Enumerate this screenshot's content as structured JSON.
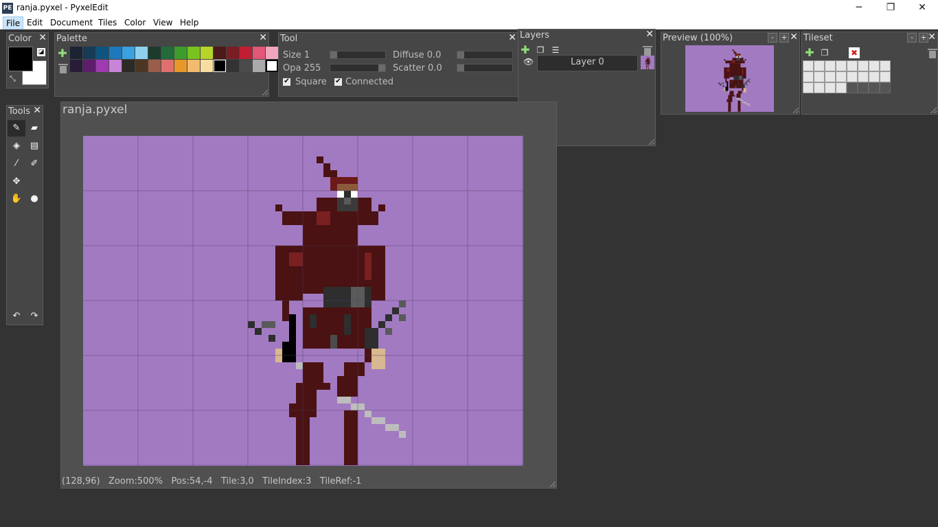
{
  "window": {
    "title": "ranja.pyxel - PyxelEdit",
    "icon_text": "PE",
    "minimize": "─",
    "restore": "❐",
    "close": "✕"
  },
  "menu": [
    "File",
    "Edit",
    "Document",
    "Tiles",
    "Color",
    "View",
    "Help"
  ],
  "color_panel": {
    "title": "Color",
    "fg": "#000000",
    "bg": "#ffffff"
  },
  "palette_panel": {
    "title": "Palette",
    "row1": [
      "#1c2433",
      "#173a55",
      "#0e5480",
      "#1e78b9",
      "#3aa0e0",
      "#8ed1ef",
      "#1d3b2c",
      "#236b3b",
      "#3e9c2c",
      "#79c21f",
      "#b6d42a",
      "#4d1a1a",
      "#7a1e24",
      "#c01e32",
      "#e25678",
      "#f0a6bd"
    ],
    "row2": [
      "#2a1b3a",
      "#5e1d6b",
      "#a03ab3",
      "#c885d8",
      "#2d2a25",
      "#4a3623",
      "#9a5d4a",
      "#e07070",
      "#e8982a",
      "#f2bb70",
      "#f7dea0",
      "#000000",
      "#333333",
      "#4b4b4b",
      "#aaaaaa",
      "#ffffff"
    ]
  },
  "tool_panel": {
    "title": "Tool",
    "size_label": "Size 1",
    "opa_label": "Opa 255",
    "diffuse_label": "Diffuse 0.0",
    "scatter_label": "Scatter 0.0",
    "square_label": "Square",
    "connected_label": "Connected",
    "size_fraction": 0.0,
    "opa_fraction": 1.0,
    "diffuse_fraction": 0.0,
    "scatter_fraction": 0.0,
    "square_checked": true,
    "connected_checked": true
  },
  "layers_panel": {
    "title": "Layers",
    "layers": [
      {
        "name": "Layer 0",
        "visible": true
      }
    ]
  },
  "preview_panel": {
    "title": "Preview (100%)",
    "minus": "-",
    "plus": "+"
  },
  "tileset_panel": {
    "title": "Tileset",
    "minus": "-",
    "plus": "+"
  },
  "tools_panel": {
    "title": "Tools",
    "tools": [
      "pencil-icon",
      "eraser-icon",
      "fill-bucket-icon",
      "select-icon",
      "eyedropper-icon",
      "brush-icon",
      "move-icon",
      "",
      "hand-icon",
      "zoom-icon"
    ],
    "undo": "↶",
    "redo": "↷"
  },
  "document": {
    "title": "ranja.pyxel",
    "status": "(128,96)   Zoom:500%   Pos:54,-4   Tile:3,0   TileIndex:3   TileRef:-1",
    "canvas_bg": "#a27ac2"
  }
}
